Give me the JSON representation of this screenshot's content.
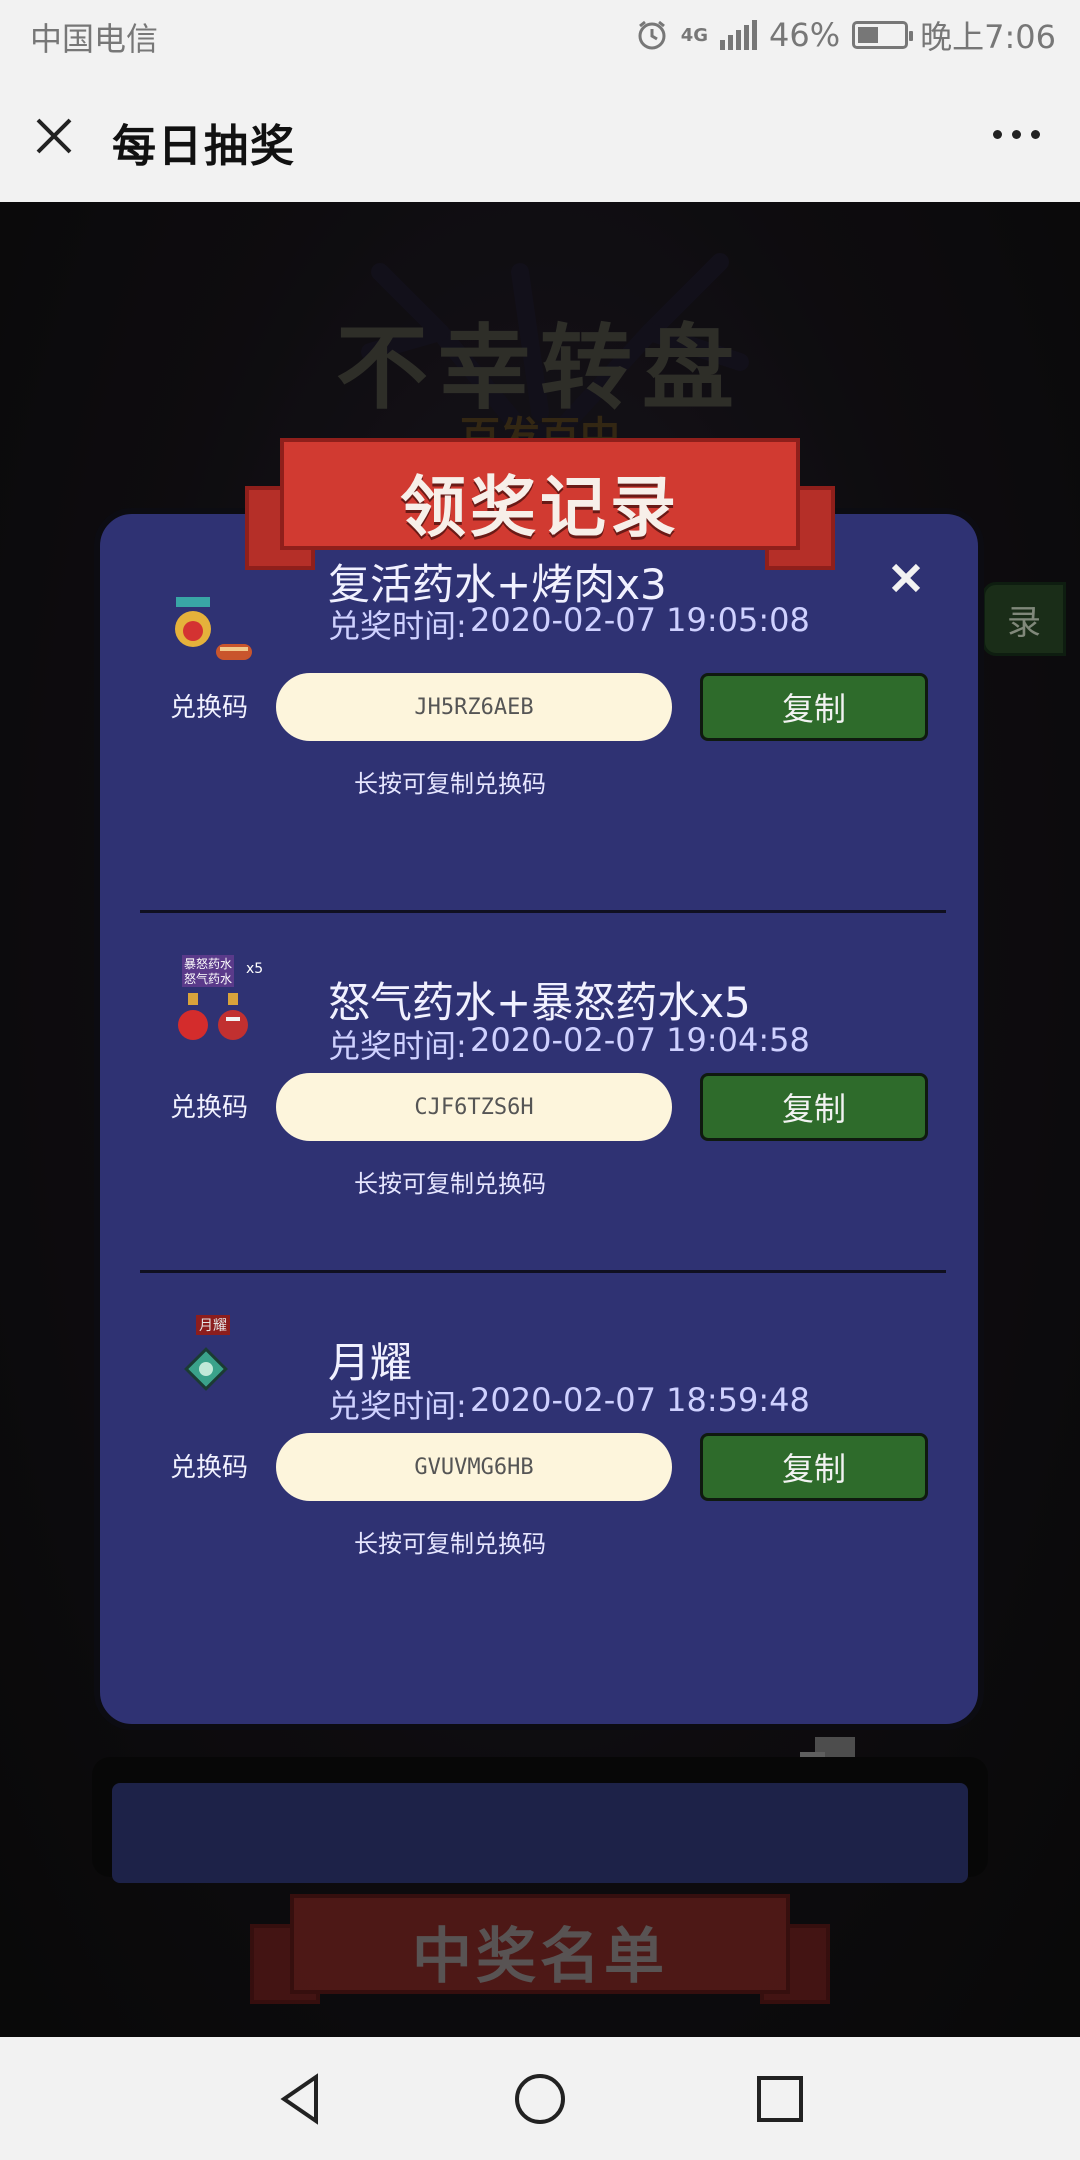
{
  "status_bar": {
    "carrier": "中国电信",
    "network": "4G",
    "battery": "46%",
    "battery_level": 0.46,
    "time": "晚上7:06"
  },
  "title_bar": {
    "title": "每日抽奖",
    "close_icon": "close-icon",
    "more_icon": "more-icon"
  },
  "background": {
    "title": "不幸转盘",
    "subtitle": "百发百中",
    "side_button": "录",
    "bottom_ribbon": "中奖名单"
  },
  "modal": {
    "title": "领奖记录",
    "close_icon": "close-icon",
    "records": [
      {
        "name": "复活药水+烤肉x3",
        "time_label": "兑奖时间:",
        "time": "2020-02-07 19:05:08",
        "code_label": "兑换码",
        "code": "JH5RZ6AEB",
        "copy": "复制",
        "hint": "长按可复制兑换码"
      },
      {
        "name": "怒气药水+暴怒药水x5",
        "time_label": "兑奖时间:",
        "time": "2020-02-07 19:04:58",
        "code_label": "兑换码",
        "code": "CJF6TZS6H",
        "copy": "复制",
        "hint": "长按可复制兑换码"
      },
      {
        "name": "月耀",
        "time_label": "兑奖时间:",
        "time": "2020-02-07 18:59:48",
        "code_label": "兑换码",
        "code": "GVUVMG6HB",
        "copy": "复制",
        "hint": "长按可复制兑换码"
      }
    ]
  },
  "icon_labels": {
    "record_2_top": "暴怒药水",
    "record_2_bottom": "怒气药水",
    "record_2_count": "x5",
    "record_3": "月耀"
  },
  "nav_bar": {
    "back_icon": "back-triangle-icon",
    "home_icon": "home-circle-icon",
    "recents_icon": "recents-square-icon"
  }
}
